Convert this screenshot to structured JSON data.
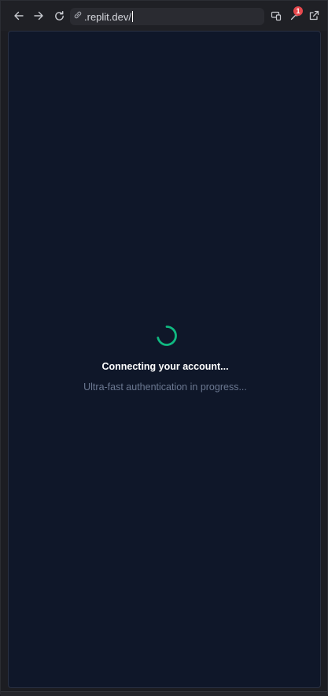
{
  "browser": {
    "url": ".replit.dev/",
    "notification_count": "1",
    "icons": {
      "back": "arrow-left-icon",
      "forward": "arrow-right-icon",
      "reload": "reload-icon",
      "link": "link-icon",
      "devices": "devices-icon",
      "devtools": "wrench-icon",
      "open_external": "external-link-icon"
    }
  },
  "page": {
    "title": "Connecting your account...",
    "subtitle": "Ultra-fast authentication in progress...",
    "spinner_color": "#10b981",
    "background_color": "#0f1729"
  }
}
